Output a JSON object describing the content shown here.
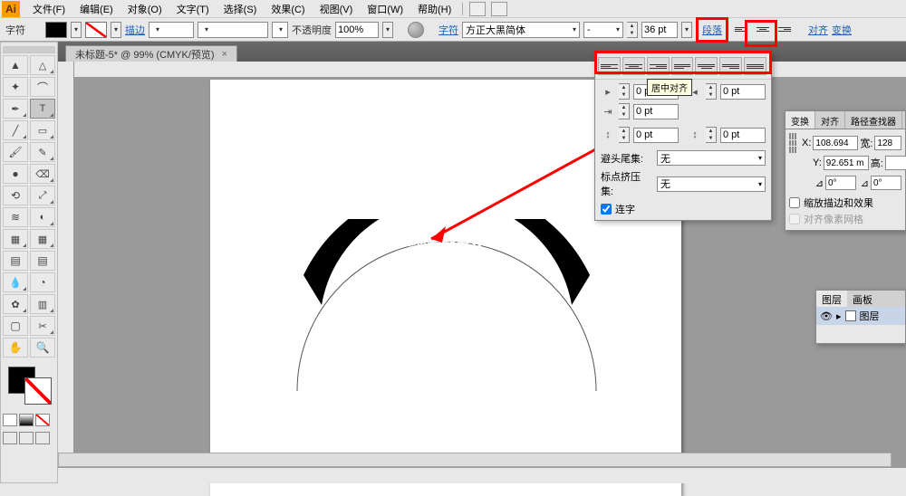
{
  "app": {
    "logo": "Ai"
  },
  "menu": {
    "file": "文件(F)",
    "edit": "编辑(E)",
    "object": "对象(O)",
    "type": "文字(T)",
    "select": "选择(S)",
    "effect": "效果(C)",
    "view": "视图(V)",
    "window": "窗口(W)",
    "help": "帮助(H)"
  },
  "optbar": {
    "char_label": "字符",
    "stroke_link": "描边",
    "opacity_label": "不透明度",
    "opacity_value": "100%",
    "char_link": "字符",
    "font_name": "方正大黑简体",
    "font_style": "-",
    "font_size": "36 pt",
    "para_link": "段落",
    "align_link": "对齐",
    "transform_link": "变换"
  },
  "doc": {
    "tab_title": "未标题-5* @ 99% (CMYK/预览)",
    "close": "×"
  },
  "canvas": {
    "text_on_path": "ai教程之路径文字"
  },
  "para_panel": {
    "tooltip": "居中对齐",
    "indent_left": "0 pt",
    "indent_right": "0 pt",
    "indent_first": "0 pt",
    "space_before": "0 pt",
    "space_after": "0 pt",
    "kinsoku_label": "避头尾集:",
    "kinsoku_value": "无",
    "mojikumi_label": "标点挤压集:",
    "mojikumi_value": "无",
    "hyphen_label": "连字"
  },
  "trans_panel": {
    "tab_transform": "变换",
    "tab_align": "对齐",
    "tab_path": "路径查找器",
    "x_label": "X:",
    "x_value": "108.694",
    "w_label": "宽:",
    "w_value": "128",
    "y_label": "Y:",
    "y_value": "92.651 m",
    "h_label": "高:",
    "angle_label": "⊿",
    "angle_value": "0°",
    "shear_label": "⊿",
    "shear_value": "0°",
    "scale_chk": "缩放描边和效果",
    "align_chk": "对齐像素网格"
  },
  "layers": {
    "tab_layers": "图层",
    "tab_artboards": "画板",
    "layer1": "图层"
  },
  "tools": {
    "selection": "▲",
    "direct": "△",
    "wand": "✦",
    "lasso": "⌒",
    "pen": "✒",
    "type": "T",
    "line": "╱",
    "rect": "▭",
    "brush": "🖌",
    "pencil": "✎",
    "blob": "●",
    "eraser": "⌫",
    "rotate": "⟲",
    "scale": "⤢",
    "width": "≋",
    "warp": "◐",
    "shape": "▦",
    "mesh": "▦",
    "gradient": "▤",
    "eyedrop": "💧",
    "blend": "◔",
    "symbol": "✿",
    "graph": "▥",
    "artboard": "▢",
    "slice": "✂",
    "hand": "✋",
    "zoom": "🔍"
  }
}
